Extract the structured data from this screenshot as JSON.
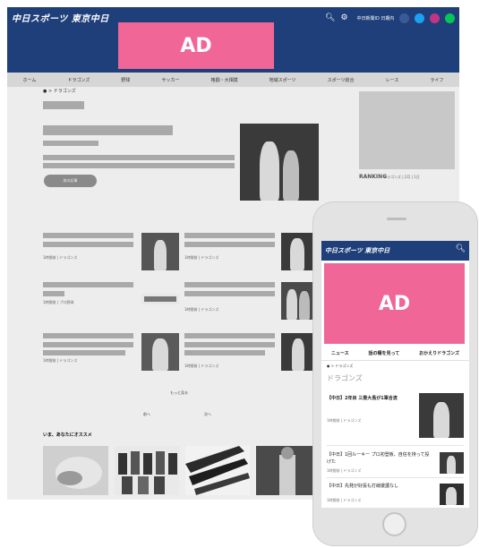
{
  "colors": {
    "header": "#1f3f7a",
    "ad": "#f06696"
  },
  "desktop": {
    "logo": "中日スポーツ 東京中日",
    "login_text": "中日新聞ID 日期内",
    "ad_label": "AD",
    "nav": [
      "ホーム",
      "ドラゴンズ",
      "野球",
      "サッカー",
      "格闘・大相撲",
      "地域スポーツ",
      "スポーツ総合",
      "レース",
      "ライフ"
    ],
    "breadcrumb": "● > ドラゴンズ",
    "button_label": "前の記事",
    "rank_title": "RANKING",
    "rank_sub": "ドラゴンズ | 2月 | 1日",
    "articles_meta": [
      "1時間前 | ドラゴンズ",
      "1時間前 | ドラゴンズ",
      "1時間前 | プロ野球",
      "1時間前 | ドラゴンズ",
      "1時間前 | ドラゴンズ",
      "1時間前 | ドラゴンズ"
    ],
    "more_label": "もっと見る",
    "pagination": [
      "前へ",
      "次へ"
    ],
    "reco_title": "いま、あなたにオススメ"
  },
  "mobile": {
    "logo": "中日スポーツ 東京中日",
    "ad_label": "AD",
    "tabs": [
      "ニュース",
      "話の種を見って",
      "おかえりドラゴンズ"
    ],
    "breadcrumb": "● > ドラゴンズ",
    "title": "ドラゴンズ",
    "articles": [
      {
        "title": "【中日】2年目 三塁大島が1軍合流",
        "meta": "1時間前 | ドラゴンズ"
      },
      {
        "title": "【中日】1回ルーキー プロ初登板、自信を持って投げた",
        "meta": "1時間前 | ドラゴンズ"
      },
      {
        "title": "【中日】先発が好投も打線援護なし",
        "meta": "1時間前 | ドラゴンズ"
      }
    ]
  }
}
